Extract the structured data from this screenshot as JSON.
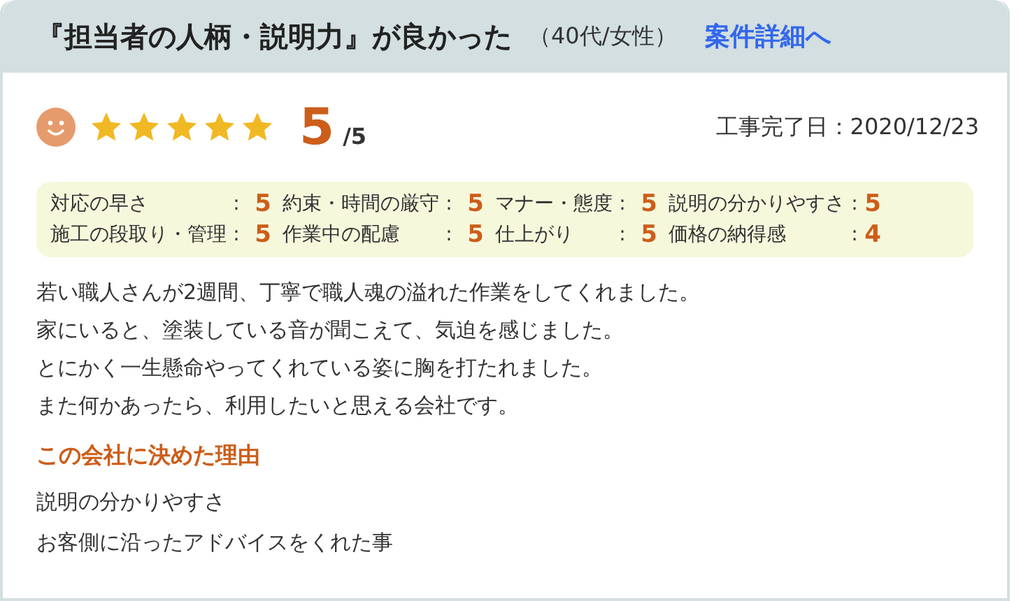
{
  "header": {
    "title": "『担当者の人柄・説明力』が良かった",
    "respondent": "（40代/女性）",
    "link": "案件詳細へ"
  },
  "summary": {
    "stars": 5,
    "score": "5",
    "out_of": "/5",
    "completion": "工事完了日：2020/12/23"
  },
  "ratings": [
    {
      "label": "対応の早さ",
      "separator": ":",
      "score": "5"
    },
    {
      "label": "約束・時間の厳守",
      "separator": ":",
      "score": "5"
    },
    {
      "label": "マナー・態度",
      "separator": ":",
      "score": "5"
    },
    {
      "label": "説明の分かりやすさ",
      "separator": ":",
      "score": "5"
    },
    {
      "label": "施工の段取り・管理",
      "separator": ":",
      "score": "5"
    },
    {
      "label": "作業中の配慮",
      "separator": ":",
      "score": "5"
    },
    {
      "label": "仕上がり",
      "separator": ":",
      "score": "5"
    },
    {
      "label": "価格の納得感",
      "separator": ":",
      "score": "4"
    }
  ],
  "comment": [
    "若い職人さんが2週間、丁寧で職人魂の溢れた作業をしてくれました。",
    "家にいると、塗装している音が聞こえて、気迫を感じました。",
    "とにかく一生懸命やってくれている姿に胸を打たれました。",
    "また何かあったら、利用したいと思える会社です。"
  ],
  "reason": {
    "heading": "この会社に決めた理由",
    "lines": [
      "説明の分かりやすさ",
      "お客側に沿ったアドバイスをくれた事"
    ]
  }
}
